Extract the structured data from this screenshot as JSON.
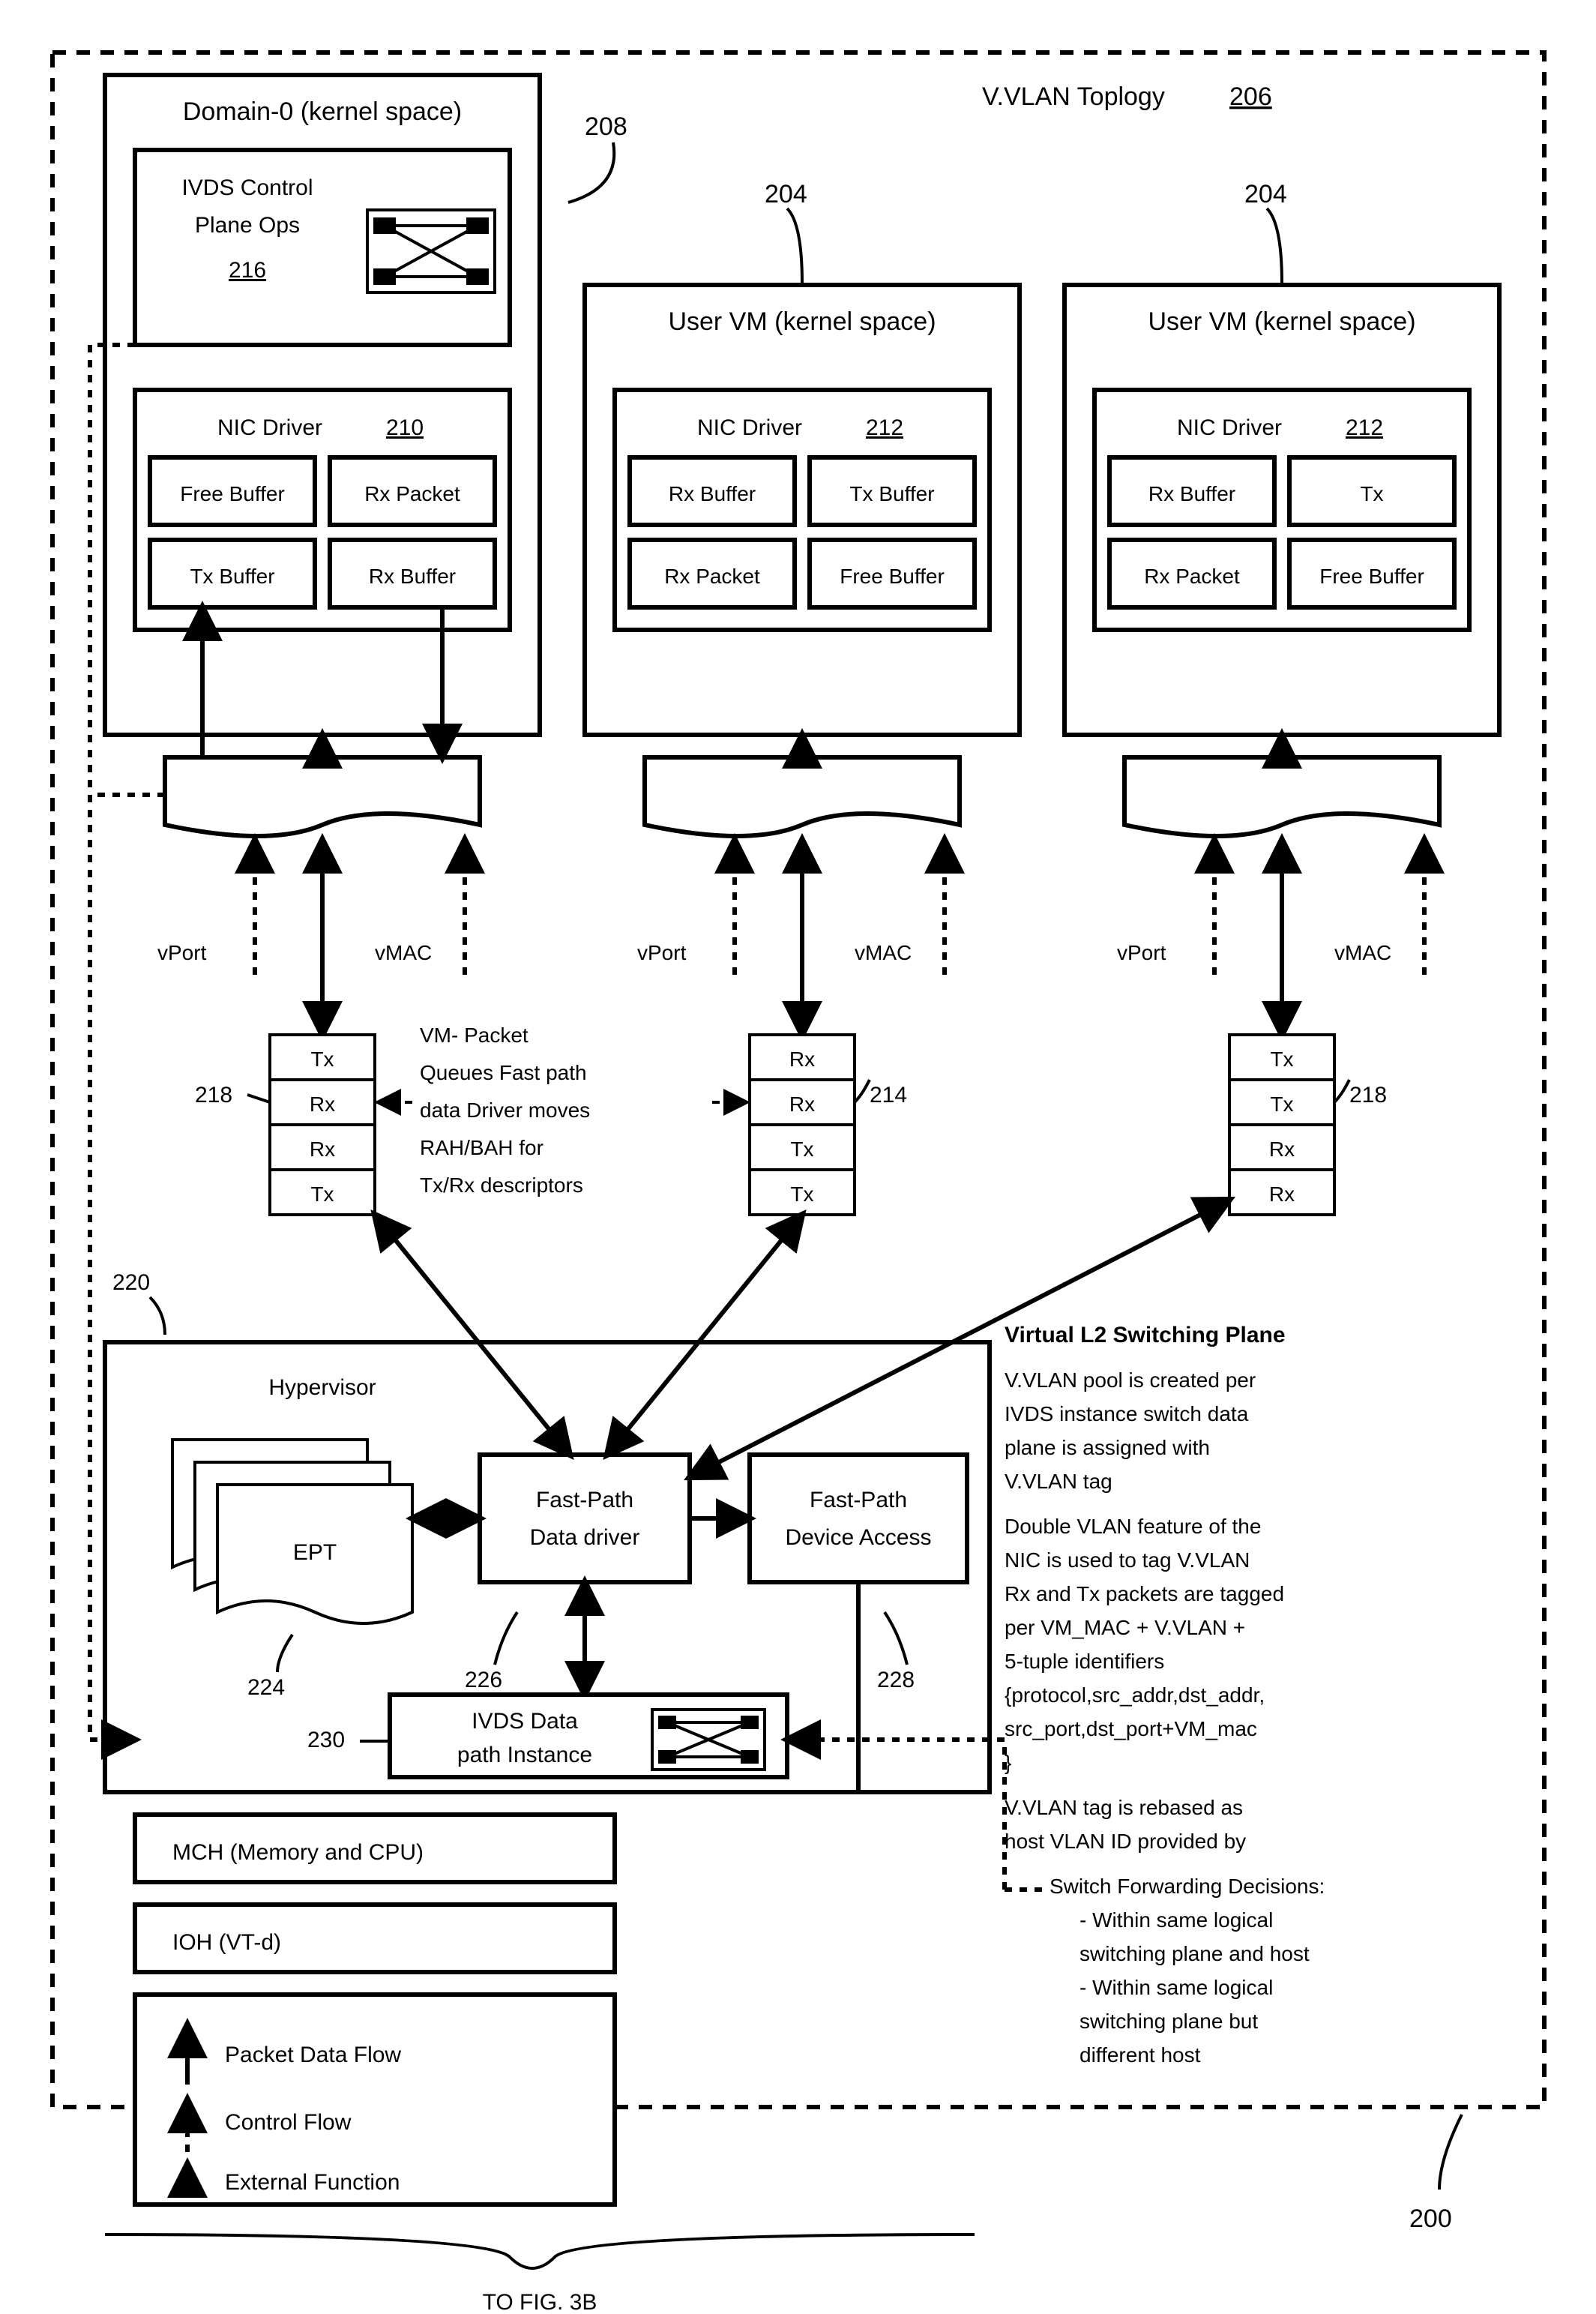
{
  "figure_ref": {
    "top": "TO FIG. 3B",
    "ref200": "200"
  },
  "title": {
    "vvlan": "V.VLAN Toplogy",
    "vvlan_ref": "206"
  },
  "domain0": {
    "title": "Domain-0 (kernel space)",
    "ref": "208",
    "ivds": {
      "l1": "IVDS Control",
      "l2": "Plane Ops",
      "ref": "216"
    },
    "nic": {
      "title": "NIC Driver",
      "ref": "210",
      "c": [
        "Free Buffer",
        "Rx Packet",
        "Tx Buffer",
        "Rx Buffer"
      ]
    }
  },
  "uvm": {
    "title": "User VM (kernel space)",
    "ref": "204",
    "nic": {
      "title": "NIC Driver",
      "ref": "212",
      "c": [
        "Rx Buffer",
        "Tx Buffer",
        "Rx Packet",
        "Free Buffer"
      ]
    }
  },
  "uvm2": {
    "title": "User VM (kernel space)",
    "ref": "204",
    "nic": {
      "title": "NIC Driver",
      "ref": "212",
      "c": [
        "Rx Buffer",
        "Tx",
        "Rx Packet",
        "Free Buffer"
      ]
    }
  },
  "ports": {
    "vport": "vPort",
    "vmac": "vMAC"
  },
  "q": {
    "ref214": "214",
    "ref218": "218",
    "left": [
      "Tx",
      "Rx",
      "Rx",
      "Tx"
    ],
    "mid": [
      "Rx",
      "Rx",
      "Tx",
      "Tx"
    ],
    "right": [
      "Tx",
      "Tx",
      "Rx",
      "Rx"
    ],
    "note": [
      "VM- Packet",
      "Queues Fast path",
      "data Driver moves",
      "RAH/BAH for",
      "Tx/Rx descriptors"
    ]
  },
  "hyp": {
    "title": "Hypervisor",
    "ref": "220",
    "ept": "EPT",
    "ept_ref": "224",
    "fpd": {
      "l1": "Fast-Path",
      "l2": "Data driver",
      "ref": "226"
    },
    "fpa": {
      "l1": "Fast-Path",
      "l2": "Device Access",
      "ref": "228"
    },
    "ivds": {
      "l1": "IVDS Data",
      "l2": "path Instance",
      "ref": "230"
    }
  },
  "hw": {
    "mch": "MCH (Memory and CPU)",
    "ioh": "IOH (VT-d)"
  },
  "legend": {
    "pdf": "Packet Data Flow",
    "cf": "Control Flow",
    "ef": "External Function"
  },
  "side": {
    "title": "Virtual L2 Switching Plane",
    "p1": [
      "V.VLAN pool is created per",
      "IVDS instance switch data",
      "plane is assigned with",
      "V.VLAN tag"
    ],
    "p2": [
      "Double VLAN feature of the",
      "NIC is used to tag V.VLAN",
      "Rx and Tx packets are tagged",
      "per VM_MAC + V.VLAN +",
      "5-tuple identifiers",
      "{protocol,src_addr,dst_addr,",
      "src_port,dst_port+VM_mac",
      "}"
    ],
    "p3": [
      "V.VLAN tag is rebased as",
      "host VLAN ID provided by"
    ],
    "p4": [
      "Switch Forwarding Decisions:",
      "- Within same logical",
      "   switching plane and host",
      "- Within same logical",
      "   switching plane but",
      "   different host"
    ]
  }
}
